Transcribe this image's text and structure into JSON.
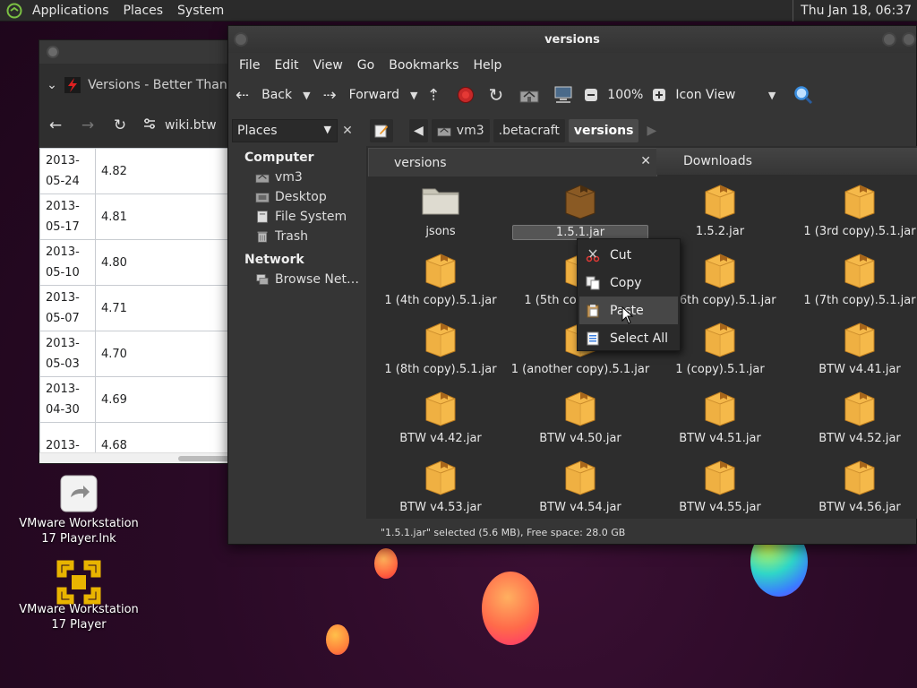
{
  "top_panel": {
    "menus": [
      "Applications",
      "Places",
      "System"
    ],
    "clock": "Thu Jan 18, 06:37"
  },
  "desktop_icons": [
    {
      "label_line1": "VMware Workstation",
      "label_line2": "17 Player.lnk",
      "icon": "shortcut-icon"
    },
    {
      "label_line1": "VMware Workstation",
      "label_line2": "17 Player",
      "icon": "vmware-icon"
    }
  ],
  "browser": {
    "tab_title": "Versions - Better Than W",
    "url": "wiki.btw",
    "rows": [
      {
        "date_line1": "2013-",
        "date_line2": "05-24",
        "version": "4.82"
      },
      {
        "date_line1": "2013-",
        "date_line2": "05-17",
        "version": "4.81"
      },
      {
        "date_line1": "2013-",
        "date_line2": "05-10",
        "version": "4.80"
      },
      {
        "date_line1": "2013-",
        "date_line2": "05-07",
        "version": "4.71"
      },
      {
        "date_line1": "2013-",
        "date_line2": "05-03",
        "version": "4.70"
      },
      {
        "date_line1": "2013-",
        "date_line2": "04-30",
        "version": "4.69"
      },
      {
        "date_line1": "2013-",
        "date_line2": "",
        "version": "4.68"
      }
    ]
  },
  "file_manager": {
    "title": "versions",
    "menubar": [
      "File",
      "Edit",
      "View",
      "Go",
      "Bookmarks",
      "Help"
    ],
    "toolbar": {
      "back": "Back",
      "forward": "Forward",
      "zoom": "100%",
      "view_mode": "Icon View"
    },
    "places_combo": "Places",
    "breadcrumbs": [
      "vm3",
      ".betacraft",
      "versions"
    ],
    "sidebar": {
      "computer_header": "Computer",
      "computer_items": [
        "vm3",
        "Desktop",
        "File System",
        "Trash"
      ],
      "network_header": "Network",
      "network_items": [
        "Browse Net…"
      ]
    },
    "tabs": {
      "active": "versions",
      "inactive": "Downloads"
    },
    "files": [
      {
        "name": "jsons",
        "type": "folder"
      },
      {
        "name": "1.5.1.jar",
        "type": "jar",
        "selected": true
      },
      {
        "name": "1.5.2.jar",
        "type": "jar"
      },
      {
        "name": "1 (3rd copy).5.1.jar",
        "type": "jar"
      },
      {
        "name": "1 (4th copy).5.1.jar",
        "type": "jar"
      },
      {
        "name": "1 (5th copy).5.1.jar",
        "type": "jar"
      },
      {
        "name": "1 (6th copy).5.1.jar",
        "type": "jar"
      },
      {
        "name": "1 (7th copy).5.1.jar",
        "type": "jar"
      },
      {
        "name": "1 (8th copy).5.1.jar",
        "type": "jar"
      },
      {
        "name": "1 (another copy).5.1.jar",
        "type": "jar"
      },
      {
        "name": "1 (copy).5.1.jar",
        "type": "jar"
      },
      {
        "name": "BTW v4.41.jar",
        "type": "jar"
      },
      {
        "name": "BTW v4.42.jar",
        "type": "jar"
      },
      {
        "name": "BTW v4.50.jar",
        "type": "jar"
      },
      {
        "name": "BTW v4.51.jar",
        "type": "jar"
      },
      {
        "name": "BTW v4.52.jar",
        "type": "jar"
      },
      {
        "name": "BTW v4.53.jar",
        "type": "jar"
      },
      {
        "name": "BTW v4.54.jar",
        "type": "jar"
      },
      {
        "name": "BTW v4.55.jar",
        "type": "jar"
      },
      {
        "name": "BTW v4.56.jar",
        "type": "jar"
      }
    ],
    "status": "\"1.5.1.jar\" selected (5.6 MB), Free space: 28.0 GB"
  },
  "context_menu": {
    "items": [
      {
        "label": "Cut",
        "icon": "scissors-icon"
      },
      {
        "label": "Copy",
        "icon": "copy-icon"
      },
      {
        "label": "Paste",
        "icon": "paste-icon",
        "hover": true
      },
      {
        "label": "Select All",
        "icon": "select-all-icon"
      }
    ]
  },
  "colors": {
    "jar_box": "#e8a93c",
    "folder": "#c9c6b8",
    "accent_search": "#3a8dde"
  }
}
